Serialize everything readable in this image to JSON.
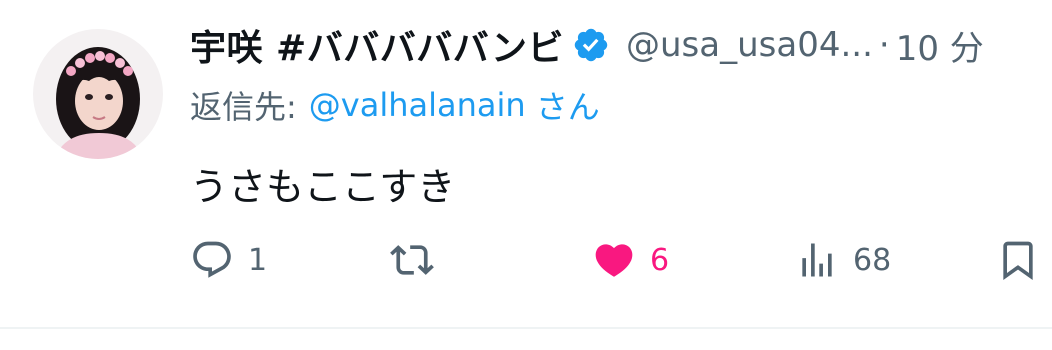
{
  "tweet": {
    "display_name": "宇咲 #バババババンビ",
    "handle": "@usa_usa04...",
    "separator": "·",
    "time": "10 分",
    "reply_prefix": "返信先:",
    "reply_user": "@valhalanain",
    "reply_suffix": "さん",
    "text": "うさもここすき"
  },
  "actions": {
    "replies": "1",
    "likes": "6",
    "views": "68"
  },
  "icons": {
    "verified": "verified-badge-icon",
    "reply": "reply-icon",
    "retweet": "retweet-icon",
    "like": "heart-icon",
    "views": "views-icon",
    "bookmark": "bookmark-icon"
  },
  "colors": {
    "text": "#0f1419",
    "muted": "#536471",
    "link": "#1d9bf0",
    "like": "#f91880",
    "verified": "#1d9bf0"
  }
}
